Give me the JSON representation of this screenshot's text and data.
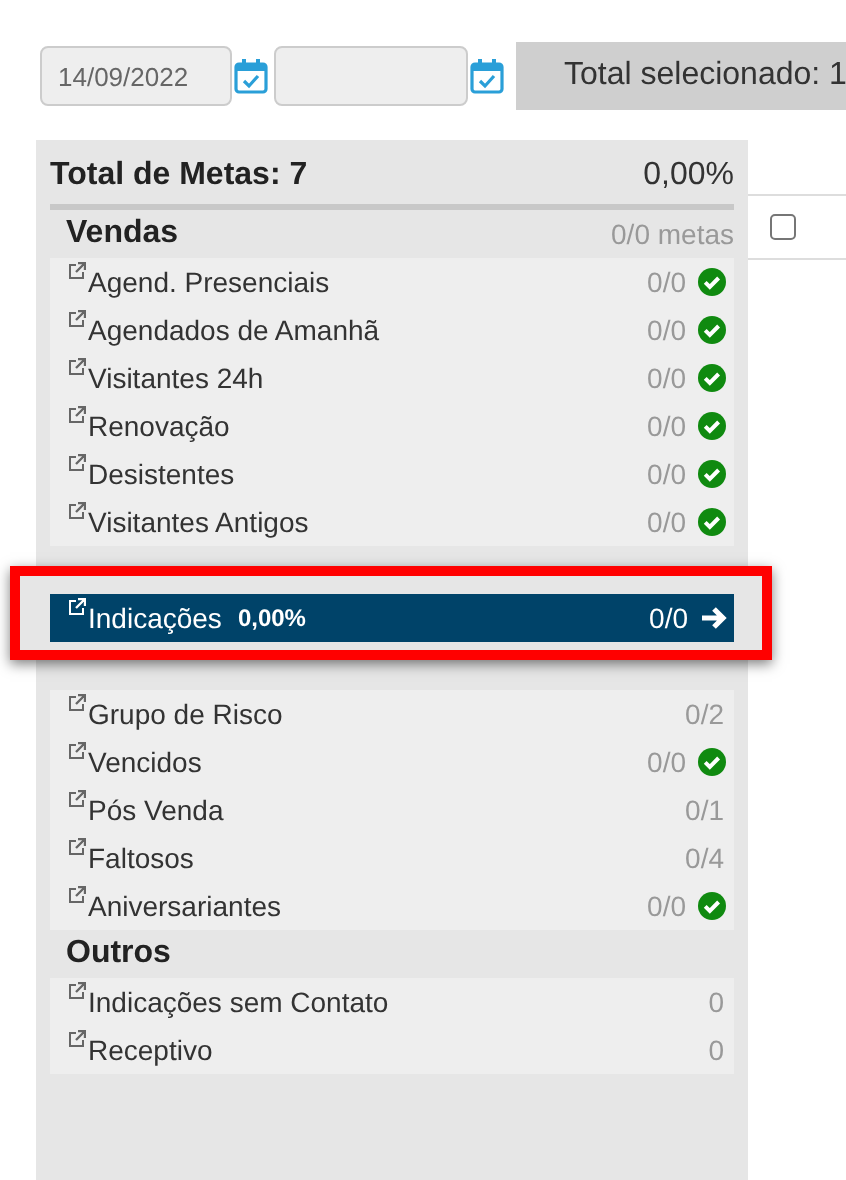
{
  "filters": {
    "start_date": "14/09/2022"
  },
  "total_selected": "Total selecionado: 1",
  "panel": {
    "title": "Total de Metas: 7",
    "percent": "0,00%"
  },
  "sections": [
    {
      "title": "Vendas",
      "count": "0/0 metas",
      "items": [
        {
          "label": "Agend. Presenciais",
          "count": "0/0",
          "done": true,
          "selected": false
        },
        {
          "label": "Agendados de Amanhã",
          "count": "0/0",
          "done": true,
          "selected": false
        },
        {
          "label": "Visitantes 24h",
          "count": "0/0",
          "done": true,
          "selected": false
        },
        {
          "label": "Renovação",
          "count": "0/0",
          "done": true,
          "selected": false
        },
        {
          "label": "Desistentes",
          "count": "0/0",
          "done": true,
          "selected": false
        },
        {
          "label": "Visitantes Antigos",
          "count": "0/0",
          "done": true,
          "selected": false
        },
        {
          "label": "Indicações",
          "percent": "0,00%",
          "count": "0/0",
          "done": false,
          "selected": true
        }
      ]
    },
    {
      "items": [
        {
          "label": "Grupo de Risco",
          "count": "0/2",
          "done": false,
          "selected": false
        },
        {
          "label": "Vencidos",
          "count": "0/0",
          "done": true,
          "selected": false
        },
        {
          "label": "Pós Venda",
          "count": "0/1",
          "done": false,
          "selected": false
        },
        {
          "label": "Faltosos",
          "count": "0/4",
          "done": false,
          "selected": false
        },
        {
          "label": "Aniversariantes",
          "count": "0/0",
          "done": true,
          "selected": false
        }
      ]
    },
    {
      "title": "Outros",
      "items": [
        {
          "label": "Indicações sem Contato",
          "count": "0",
          "done": false,
          "selected": false
        },
        {
          "label": "Receptivo",
          "count": "0",
          "done": false,
          "selected": false
        }
      ]
    }
  ],
  "table": {
    "rows": [
      {
        "checked": false
      }
    ]
  }
}
